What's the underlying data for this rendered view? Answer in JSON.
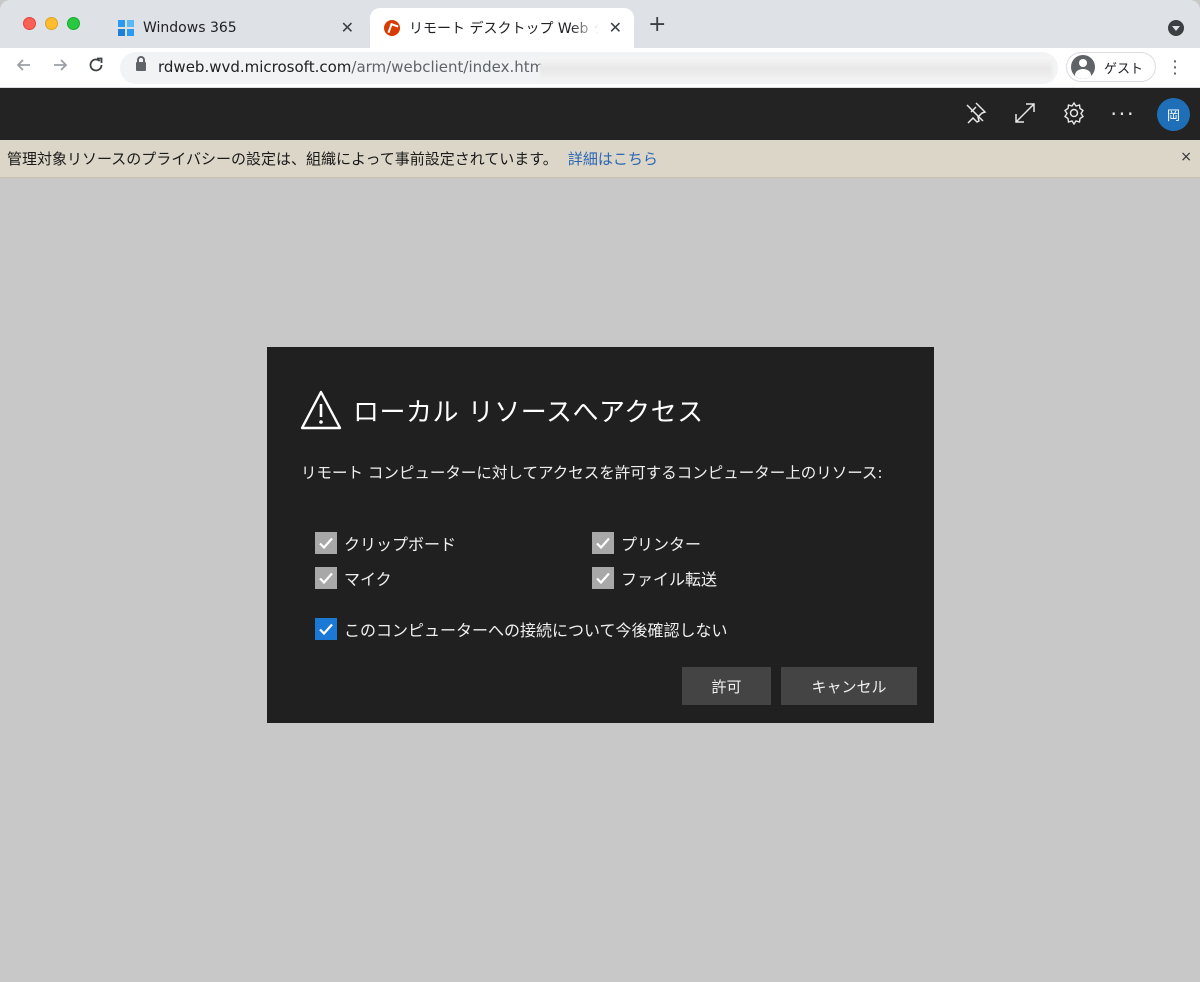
{
  "browser": {
    "tabs": [
      {
        "title": "Windows 365",
        "active": false
      },
      {
        "title": "リモート デスクトップ Web クライアント",
        "active": true
      }
    ],
    "url_host": "rdweb.wvd.microsoft.com",
    "url_path": "/arm/webclient/index.html?",
    "profile_label": "ゲスト"
  },
  "toolbar": {
    "user_initial": "岡"
  },
  "notice": {
    "text": "管理対象リソースのプライバシーの設定は、組織によって事前設定されています。",
    "link": "詳細はこちら",
    "close": "×"
  },
  "dialog": {
    "title": "ローカル リソースへアクセス",
    "description": "リモート コンピューターに対してアクセスを許可するコンピューター上のリソース:",
    "resources": [
      {
        "label": "クリップボード",
        "checked": true
      },
      {
        "label": "プリンター",
        "checked": true
      },
      {
        "label": "マイク",
        "checked": true
      },
      {
        "label": "ファイル転送",
        "checked": true
      }
    ],
    "dont_ask": {
      "label": "このコンピューターへの接続について今後確認しない",
      "checked": true
    },
    "allow_label": "許可",
    "cancel_label": "キャンセル"
  },
  "colors": {
    "accent": "#1b78d4",
    "dialog_bg": "#202020",
    "notice_bg": "#dbd6c7",
    "link": "#2a66b5"
  }
}
